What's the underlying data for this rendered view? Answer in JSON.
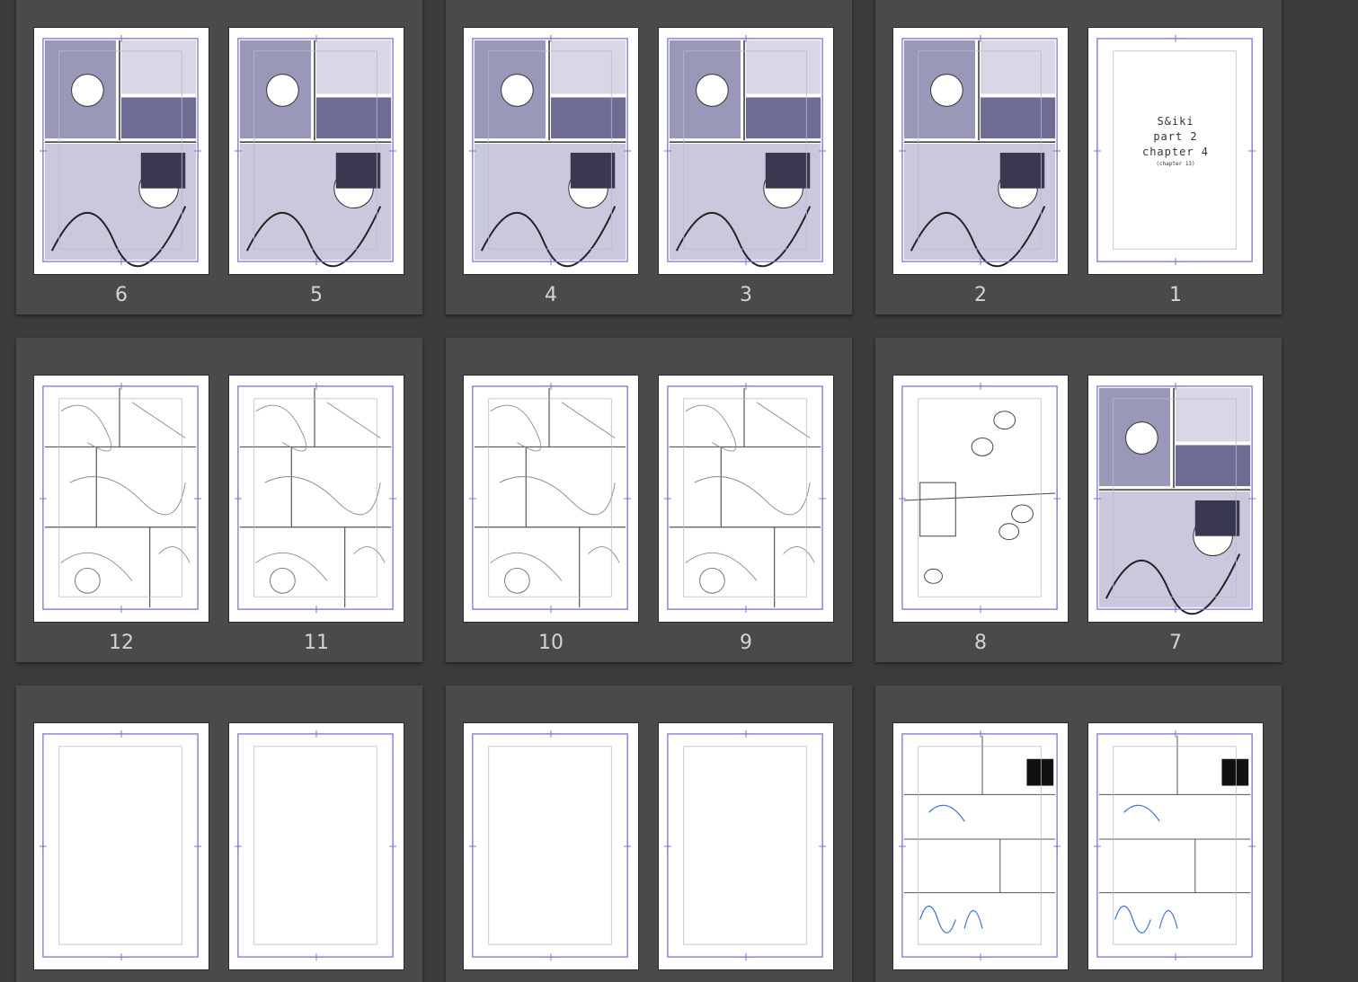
{
  "app": {
    "view": "page-manager"
  },
  "colors": {
    "background": "#3b3b3b",
    "spread": "#4a4a4a",
    "guide": "#7b74d6",
    "selected": "#76819b",
    "label": "#d4d4d4"
  },
  "rows": [
    {
      "spreads": [
        {
          "pages": [
            {
              "number": "6",
              "kind": "toned"
            },
            {
              "number": "5",
              "kind": "toned"
            }
          ]
        },
        {
          "pages": [
            {
              "number": "4",
              "kind": "toned"
            },
            {
              "number": "3",
              "kind": "toned"
            }
          ]
        },
        {
          "pages": [
            {
              "number": "2",
              "kind": "toned"
            },
            {
              "number": "1",
              "kind": "title"
            }
          ]
        }
      ]
    },
    {
      "spreads": [
        {
          "pages": [
            {
              "number": "12",
              "kind": "lineart"
            },
            {
              "number": "11",
              "kind": "lineart"
            }
          ]
        },
        {
          "pages": [
            {
              "number": "10",
              "kind": "lineart"
            },
            {
              "number": "9",
              "kind": "lineart"
            }
          ]
        },
        {
          "pages": [
            {
              "number": "8",
              "kind": "bubbles",
              "selected": true
            },
            {
              "number": "7",
              "kind": "toned"
            }
          ]
        }
      ]
    },
    {
      "spreads": [
        {
          "pages": [
            {
              "kind": "blank"
            },
            {
              "kind": "blank"
            }
          ]
        },
        {
          "pages": [
            {
              "kind": "blank"
            },
            {
              "kind": "blank"
            }
          ]
        },
        {
          "pages": [
            {
              "kind": "sketch"
            },
            {
              "kind": "sketch"
            }
          ]
        }
      ]
    }
  ],
  "title_page": {
    "line1": "S&iki",
    "line2": "part 2",
    "line3": "chapter 4",
    "line4": "(chapter 13)"
  }
}
